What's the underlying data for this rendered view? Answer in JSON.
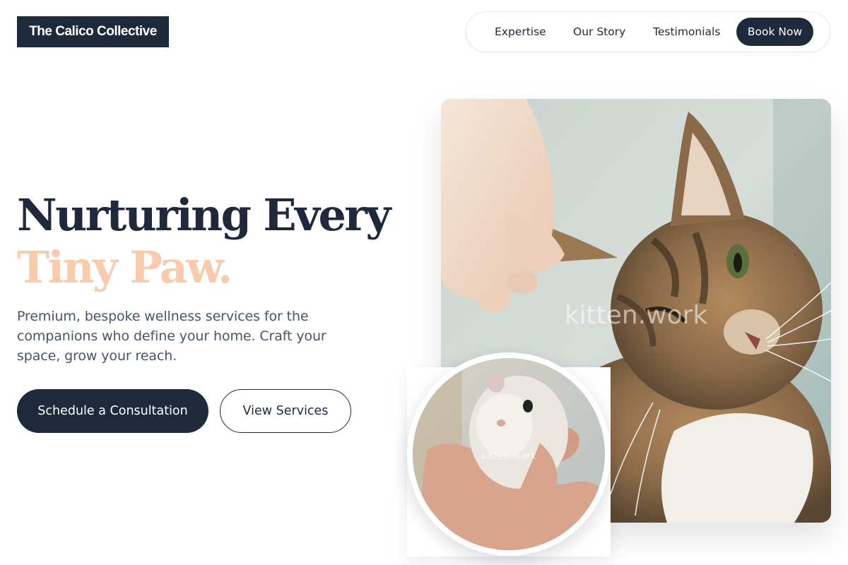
{
  "header": {
    "logo": "The Calico Collective",
    "nav": {
      "links": [
        "Expertise",
        "Our Story",
        "Testimonials"
      ],
      "cta": "Book Now"
    }
  },
  "hero": {
    "headline_line1": "Nurturing Every",
    "headline_line2": "Tiny Paw.",
    "description": "Premium, bespoke wellness services for the companions who define your home. Craft your space, grow your reach.",
    "primary_button": "Schedule a Consultation",
    "secondary_button": "View Services"
  },
  "images": {
    "main_watermark": "kitten.work",
    "inset_watermark": "kitten.work"
  },
  "colors": {
    "navy": "#1e293b",
    "peach_accent": "#f8cbad",
    "body_text": "#475569"
  }
}
